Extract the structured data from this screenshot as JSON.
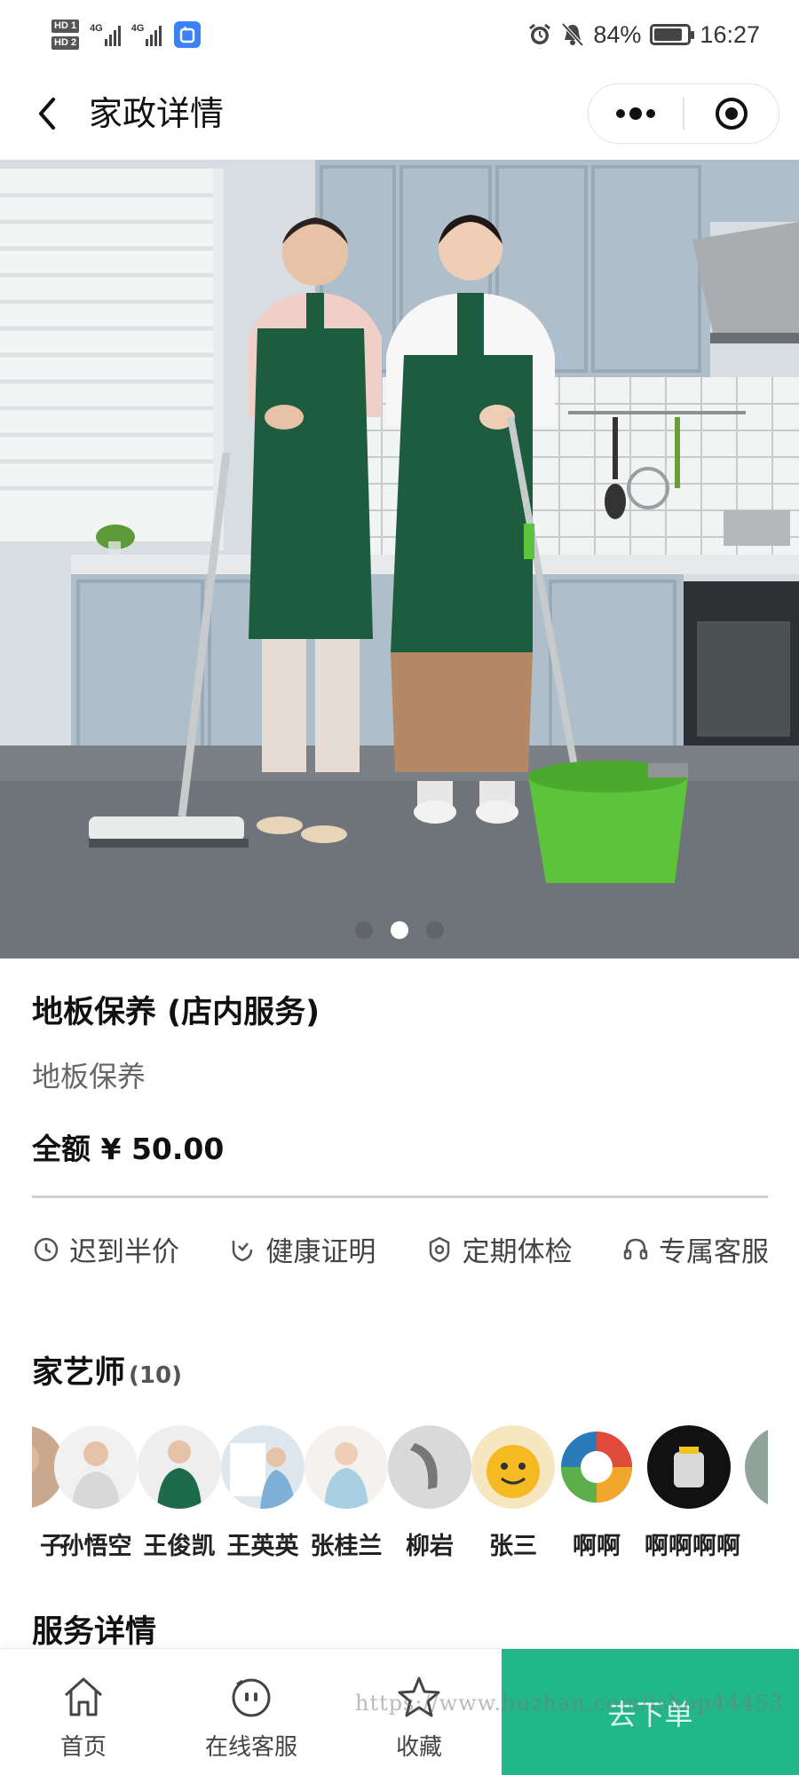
{
  "status_bar": {
    "hd1": "HD 1",
    "hd2": "HD 2",
    "net1": "4G",
    "net2": "4G",
    "battery": "84%",
    "battery_level": 0.84,
    "time": "16:27"
  },
  "nav": {
    "title": "家政详情"
  },
  "carousel": {
    "slide_count": 3,
    "active_index": 1
  },
  "product": {
    "title": "地板保养 (店内服务)",
    "subtitle": "地板保养",
    "price": "全额 ¥ 50.00"
  },
  "features": [
    {
      "icon": "clock-icon",
      "label": "迟到半价"
    },
    {
      "icon": "health-shield-icon",
      "label": "健康证明"
    },
    {
      "icon": "checkup-badge-icon",
      "label": "定期体检"
    },
    {
      "icon": "headset-icon",
      "label": "专属客服"
    }
  ],
  "staff_section": {
    "title": "家艺师",
    "count": "(10)",
    "staff": [
      {
        "name": "子"
      },
      {
        "name": "孙悟空"
      },
      {
        "name": "王俊凯"
      },
      {
        "name": "王英英"
      },
      {
        "name": "张桂兰"
      },
      {
        "name": "柳岩"
      },
      {
        "name": "张三"
      },
      {
        "name": "啊啊"
      },
      {
        "name": "啊啊啊啊"
      }
    ]
  },
  "details_section": {
    "title": "服务详情"
  },
  "bottom_bar": {
    "home": "首页",
    "service": "在线客服",
    "favorite": "收藏",
    "cta": "去下单",
    "watermark": "https://www.huzhan.com/ishop44453"
  },
  "colors": {
    "accent": "#22b788",
    "apron": "#1e5c40",
    "bucket": "#5cc33a"
  }
}
